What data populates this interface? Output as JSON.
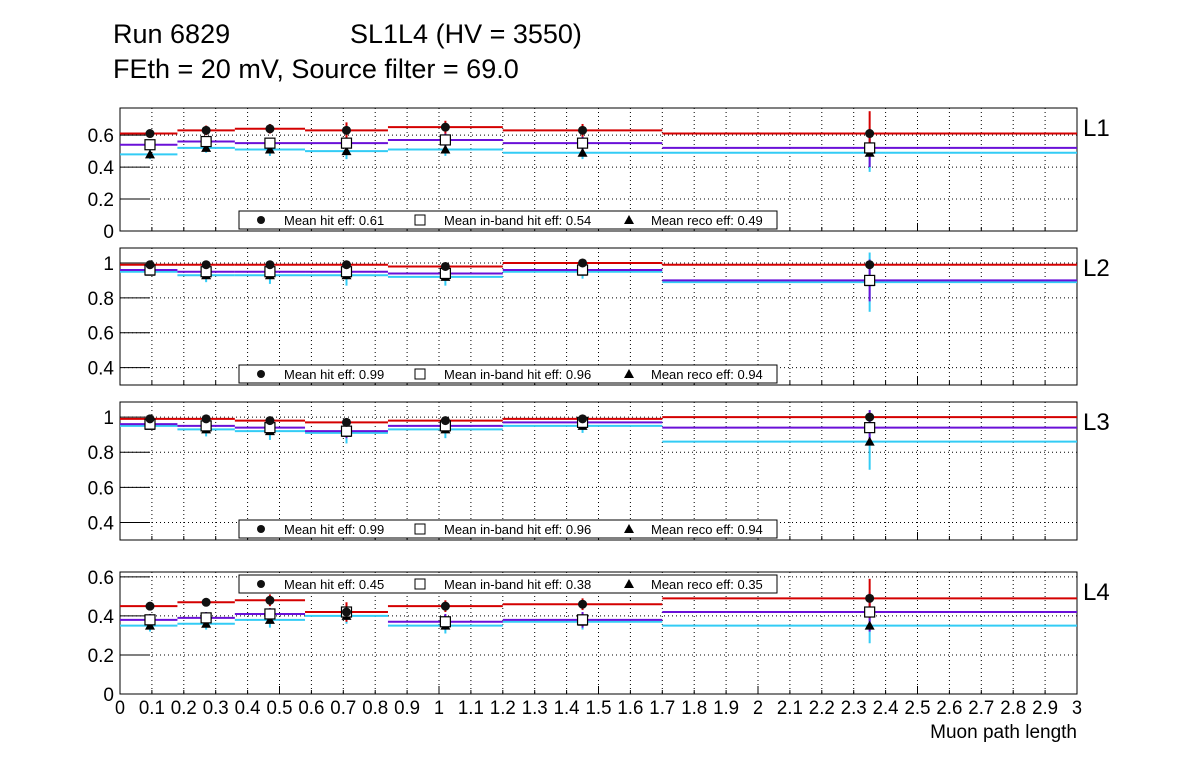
{
  "title": {
    "line1_left": "Run 6829",
    "line1_right": "SL1L4 (HV = 3550)",
    "line2": "FEth = 20 mV, Source filter = 69.0"
  },
  "colors": {
    "hit": "#d40000",
    "inband": "#6a10d8",
    "reco": "#33ccf5"
  },
  "chart_data": {
    "type": "line",
    "xlabel": "Muon path length",
    "xlim": [
      0,
      3
    ],
    "x_tick_labels": [
      "0",
      "0.1",
      "0.2",
      "0.3",
      "0.4",
      "0.5",
      "0.6",
      "0.7",
      "0.8",
      "0.9",
      "1",
      "1.1",
      "1.2",
      "1.3",
      "1.4",
      "1.5",
      "1.6",
      "1.7",
      "1.8",
      "1.9",
      "2",
      "2.1",
      "2.2",
      "2.3",
      "2.4",
      "2.5",
      "2.6",
      "2.7",
      "2.8",
      "2.9",
      "3"
    ],
    "x_ticks": [
      0,
      0.1,
      0.2,
      0.3,
      0.4,
      0.5,
      0.6,
      0.7,
      0.8,
      0.9,
      1,
      1.1,
      1.2,
      1.3,
      1.4,
      1.5,
      1.6,
      1.7,
      1.8,
      1.9,
      2,
      2.1,
      2.2,
      2.3,
      2.4,
      2.5,
      2.6,
      2.7,
      2.8,
      2.9,
      3
    ],
    "grid": true,
    "bin_edges": [
      0,
      0.18,
      0.36,
      0.58,
      0.84,
      1.2,
      1.7,
      3
    ],
    "point_x": [
      0.094,
      0.27,
      0.47,
      0.71,
      1.02,
      1.45,
      2.35
    ],
    "panels": [
      {
        "label": "L1",
        "ylim": [
          0,
          0.77
        ],
        "y_ticks": [
          0,
          0.2,
          0.4,
          0.6
        ],
        "y_tick_labels": [
          "0",
          "0.2",
          "0.4",
          "0.6"
        ],
        "legend_position": "bottom",
        "legend": [
          "Mean hit  eff: 0.61",
          "Mean in-band hit eff: 0.54",
          "Mean reco eff: 0.49"
        ],
        "series": [
          {
            "name": "hit",
            "values": [
              0.61,
              0.63,
              0.64,
              0.63,
              0.65,
              0.63,
              0.61
            ],
            "errors": [
              0.02,
              0.03,
              0.03,
              0.05,
              0.04,
              0.04,
              0.14
            ]
          },
          {
            "name": "inband",
            "values": [
              0.54,
              0.56,
              0.55,
              0.55,
              0.57,
              0.55,
              0.52
            ],
            "errors": [
              0.03,
              0.03,
              0.03,
              0.04,
              0.04,
              0.04,
              0.12
            ]
          },
          {
            "name": "reco",
            "values": [
              0.48,
              0.52,
              0.51,
              0.5,
              0.51,
              0.49,
              0.49
            ],
            "errors": [
              0.03,
              0.03,
              0.04,
              0.05,
              0.04,
              0.04,
              0.12
            ]
          }
        ]
      },
      {
        "label": "L2",
        "ylim": [
          0.3,
          1.086
        ],
        "y_ticks": [
          0.4,
          0.6,
          0.8,
          1
        ],
        "y_tick_labels": [
          "0.4",
          "0.6",
          "0.8",
          "1"
        ],
        "legend_position": "bottom",
        "legend": [
          "Mean hit  eff: 0.99",
          "Mean in-band hit eff: 0.96",
          "Mean reco eff: 0.94"
        ],
        "series": [
          {
            "name": "hit",
            "values": [
              0.99,
              0.99,
              0.99,
              0.99,
              0.98,
              1.0,
              0.99
            ],
            "errors": [
              0.01,
              0.01,
              0.01,
              0.01,
              0.01,
              0.01,
              0.02
            ]
          },
          {
            "name": "inband",
            "values": [
              0.96,
              0.95,
              0.95,
              0.95,
              0.94,
              0.96,
              0.9
            ],
            "errors": [
              0.02,
              0.03,
              0.03,
              0.04,
              0.04,
              0.03,
              0.12
            ]
          },
          {
            "name": "reco",
            "values": [
              0.95,
              0.93,
              0.93,
              0.93,
              0.92,
              0.95,
              0.89
            ],
            "errors": [
              0.02,
              0.04,
              0.05,
              0.06,
              0.05,
              0.04,
              0.17
            ]
          }
        ]
      },
      {
        "label": "L3",
        "ylim": [
          0.3,
          1.086
        ],
        "y_ticks": [
          0.4,
          0.6,
          0.8,
          1
        ],
        "y_tick_labels": [
          "0.4",
          "0.6",
          "0.8",
          "1"
        ],
        "legend_position": "bottom",
        "legend": [
          "Mean hit  eff: 0.99",
          "Mean in-band hit eff: 0.96",
          "Mean reco eff: 0.94"
        ],
        "series": [
          {
            "name": "hit",
            "values": [
              0.99,
              0.99,
              0.98,
              0.97,
              0.98,
              0.99,
              1.0
            ],
            "errors": [
              0.01,
              0.01,
              0.01,
              0.01,
              0.01,
              0.01,
              0.01
            ]
          },
          {
            "name": "inband",
            "values": [
              0.96,
              0.95,
              0.94,
              0.92,
              0.95,
              0.97,
              0.94
            ],
            "errors": [
              0.02,
              0.03,
              0.03,
              0.04,
              0.04,
              0.03,
              0.1
            ]
          },
          {
            "name": "reco",
            "values": [
              0.95,
              0.93,
              0.92,
              0.91,
              0.93,
              0.95,
              0.86
            ],
            "errors": [
              0.02,
              0.04,
              0.05,
              0.06,
              0.05,
              0.04,
              0.16
            ]
          }
        ]
      },
      {
        "label": "L4",
        "ylim": [
          0,
          0.625
        ],
        "y_ticks": [
          0,
          0.2,
          0.4,
          0.6
        ],
        "y_tick_labels": [
          "0",
          "0.2",
          "0.4",
          "0.6"
        ],
        "legend_position": "top",
        "legend": [
          "Mean hit  eff: 0.45",
          "Mean in-band hit eff: 0.38",
          "Mean reco eff: 0.35"
        ],
        "series": [
          {
            "name": "hit",
            "values": [
              0.45,
              0.47,
              0.48,
              0.42,
              0.45,
              0.46,
              0.49
            ],
            "errors": [
              0.02,
              0.02,
              0.03,
              0.05,
              0.03,
              0.03,
              0.1
            ]
          },
          {
            "name": "inband",
            "values": [
              0.38,
              0.39,
              0.41,
              0.42,
              0.37,
              0.38,
              0.42
            ],
            "errors": [
              0.03,
              0.03,
              0.03,
              0.04,
              0.04,
              0.04,
              0.1
            ]
          },
          {
            "name": "reco",
            "values": [
              0.35,
              0.36,
              0.38,
              0.4,
              0.35,
              0.37,
              0.35
            ],
            "errors": [
              0.03,
              0.03,
              0.04,
              0.04,
              0.04,
              0.04,
              0.09
            ]
          }
        ]
      }
    ]
  }
}
